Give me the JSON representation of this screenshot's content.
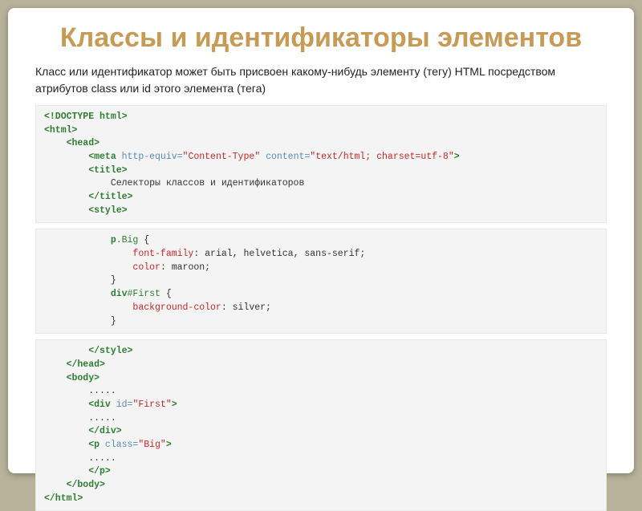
{
  "title": "Классы и идентификаторы элементов",
  "description": "Класс или идентификатор может быть присвоен какому-нибудь элементу (тегу) HTML посредством атрибутов class или id этого элемента (тега)",
  "code1": {
    "l1a": "<!DOCTYPE html>",
    "l2a": "<html>",
    "l3a": "    <head>",
    "l4a": "        <meta",
    "l4b": " http-equiv=",
    "l4c": "\"Content-Type\"",
    "l4d": " content=",
    "l4e": "\"text/html; charset=utf-8\"",
    "l4f": ">",
    "l5a": "        <title>",
    "l6a": "            Селекторы классов и идентификаторов",
    "l7a": "        </title>",
    "l8a": "        <style>"
  },
  "code2": {
    "l1a": "            p",
    "l1b": ".Big",
    "l1c": " {",
    "l2a": "                font-family",
    "l2b": ": arial, helvetica, sans-serif;",
    "l3a": "                color",
    "l3b": ": maroon;",
    "l4a": "            }",
    "l5a": "            div",
    "l5b": "#First",
    "l5c": " {",
    "l6a": "                background-color",
    "l6b": ": silver;",
    "l7a": "            }"
  },
  "code3": {
    "l1a": "        </style>",
    "l2a": "    </head>",
    "l3a": "    <body>",
    "l4a": "        .....",
    "l5a": "        <div",
    "l5b": " id=",
    "l5c": "\"First\"",
    "l5d": ">",
    "l6a": "        .....",
    "l7a": "        </div>",
    "l8a": "        <p",
    "l8b": " class=",
    "l8c": "\"Big\"",
    "l8d": ">",
    "l9a": "        .....",
    "l10a": "        </p>",
    "l11a": "    </body>",
    "l12a": "</html>"
  }
}
